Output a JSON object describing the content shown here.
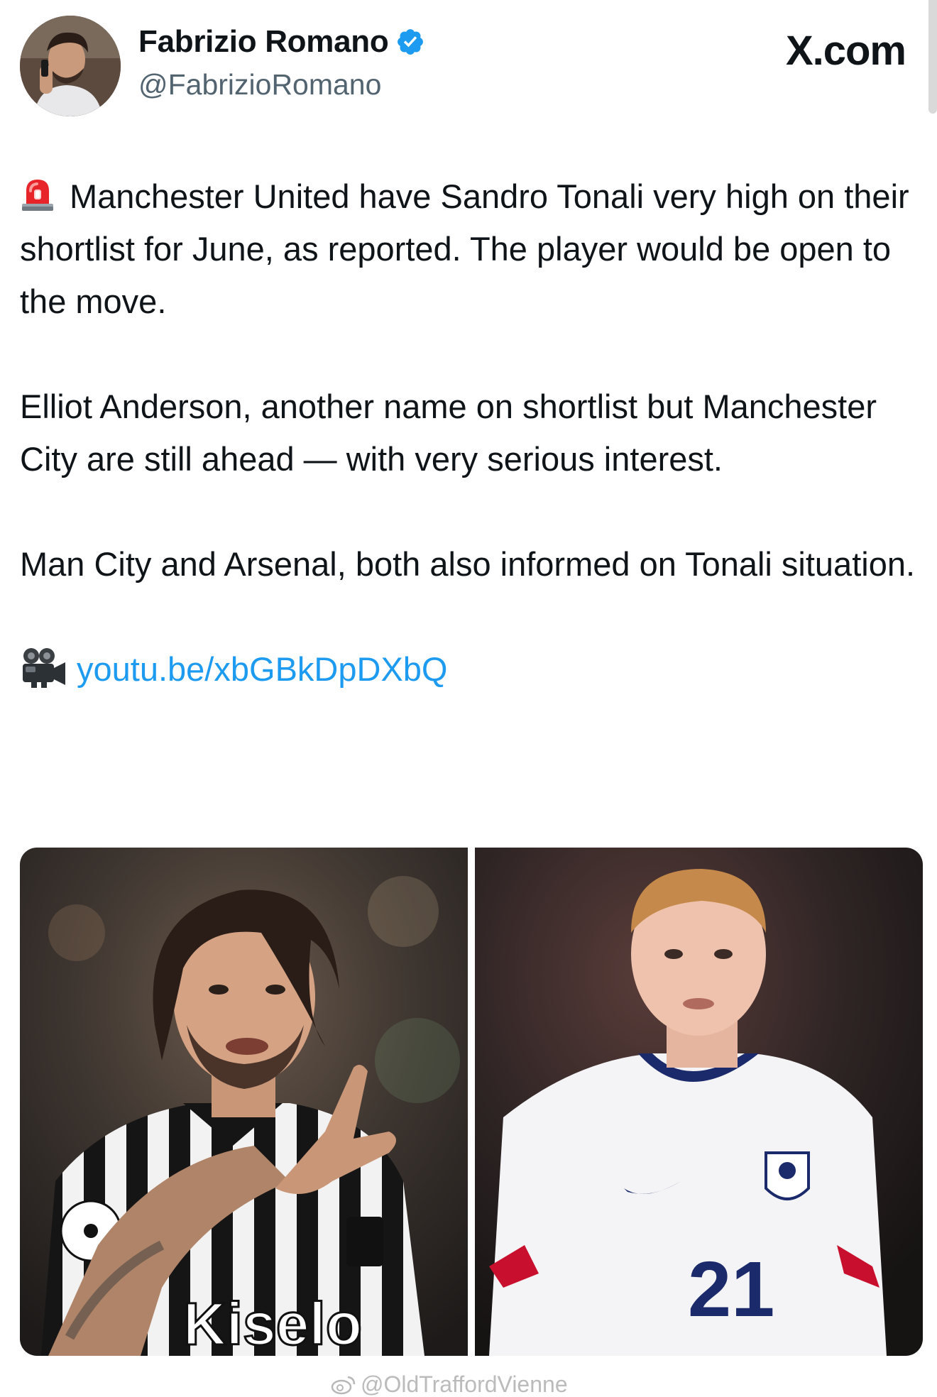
{
  "author": {
    "display_name": "Fabrizio Romano",
    "handle": "@FabrizioRomano",
    "verified": true,
    "avatar_icon": "profile-photo"
  },
  "site": {
    "brand": "X.com"
  },
  "tweet": {
    "paragraph_1": "Manchester United have Sandro Tonali very high on their shortlist for June, as reported. The player would be open to the move.",
    "paragraph_2": "Elliot Anderson, another name on shortlist but Manchester City are still ahead — with very serious interest.",
    "paragraph_3": "Man City and Arsenal, both also informed on Tonali situation.",
    "link_text": "youtu.be/xbGBkDpDXbQ",
    "paragraph_1_icon": "siren-icon",
    "link_icon": "movie-camera-icon"
  },
  "media": {
    "photo_left": {
      "jersey_sponsor": "Kiselo"
    },
    "photo_right": {
      "shirt_number": "21"
    }
  },
  "watermark": {
    "text": "@OldTraffordVienne",
    "icon": "weibo-icon"
  },
  "colors": {
    "link": "#1d9bf0",
    "verified": "#1d9bf0",
    "text_primary": "#0f1419",
    "text_secondary": "#536471"
  }
}
